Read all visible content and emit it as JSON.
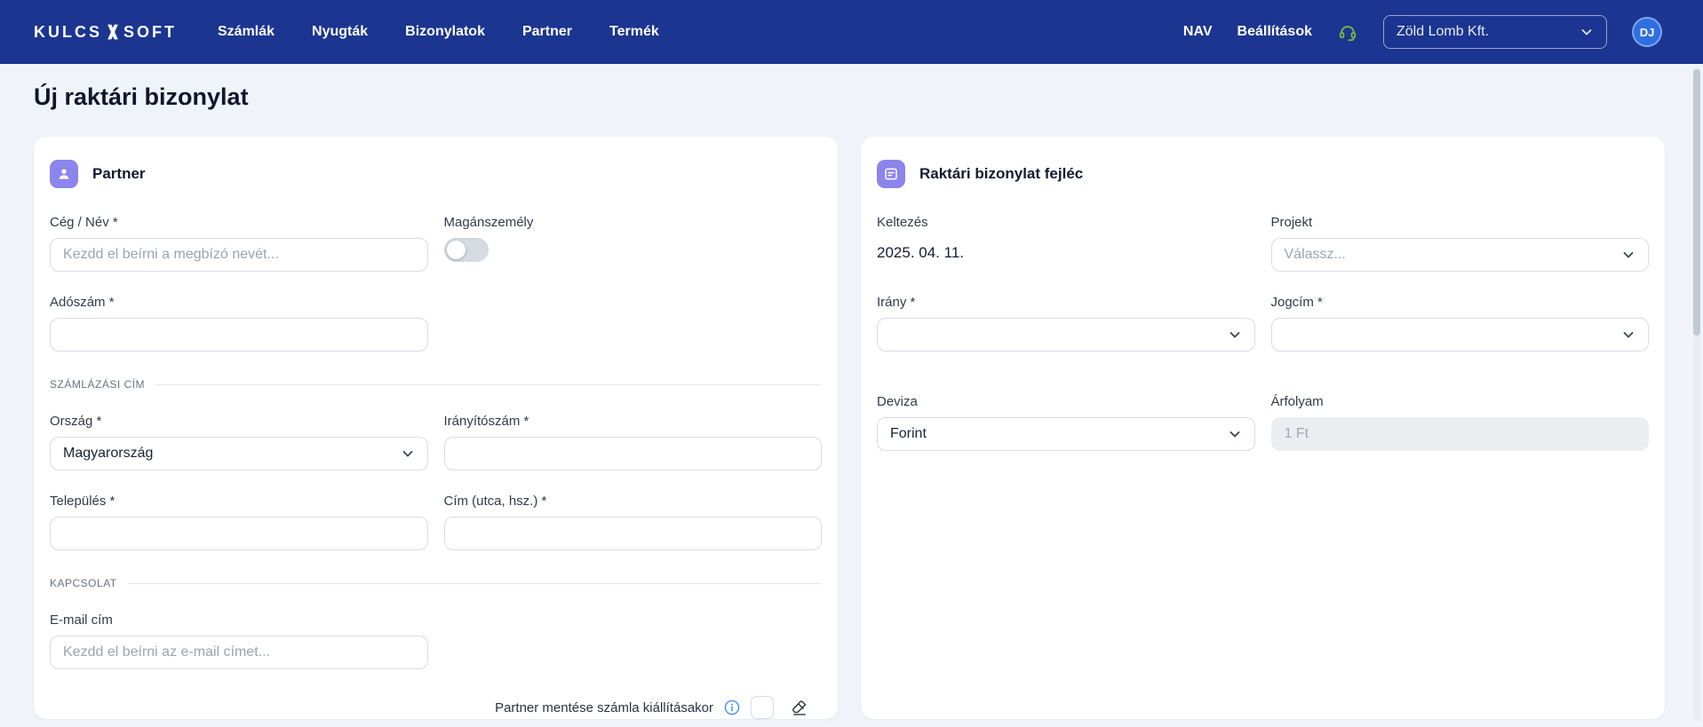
{
  "colors": {
    "nav-blue": "#1c3590",
    "accent-purple": "#8d84ec",
    "avatar-blue": "#2f6fe0",
    "info-blue": "#3f8cf3",
    "support-green": "#7cb93e",
    "page-bg": "#f0f4fa"
  },
  "nav": {
    "logo": {
      "part1": "KULCS",
      "part2": "SOFT"
    },
    "items": [
      {
        "label": "Számlák"
      },
      {
        "label": "Nyugták"
      },
      {
        "label": "Bizonylatok"
      },
      {
        "label": "Partner"
      },
      {
        "label": "Termék"
      }
    ],
    "right": {
      "nav_link": "NAV",
      "settings_link": "Beállítások",
      "company_selector": {
        "value": "Zöld Lomb Kft."
      },
      "avatar_initials": "DJ"
    }
  },
  "page": {
    "title": "Új raktári bizonylat"
  },
  "partner_card": {
    "title": "Partner",
    "sections": {
      "billing": "SZÁMLÁZÁSI CÍM",
      "contact": "KAPCSOLAT"
    },
    "fields": {
      "company_name": {
        "label": "Cég / Név *",
        "placeholder": "Kezdd el beírni a megbízó nevét...",
        "value": ""
      },
      "private_person": {
        "label": "Magánszemély",
        "state": "off"
      },
      "tax_number": {
        "label": "Adószám *",
        "value": ""
      },
      "country": {
        "label": "Ország *",
        "value": "Magyarország"
      },
      "zip": {
        "label": "Irányítószám *",
        "value": ""
      },
      "city": {
        "label": "Település *",
        "value": ""
      },
      "address": {
        "label": "Cím (utca, hsz.) *",
        "value": ""
      },
      "email": {
        "label": "E-mail cím",
        "placeholder": "Kezdd el beírni az e-mail címet...",
        "value": ""
      }
    },
    "footer": {
      "save_label": "Partner mentése számla kiállításakor"
    }
  },
  "header_card": {
    "title": "Raktári bizonylat fejléc",
    "fields": {
      "date": {
        "label": "Keltezés",
        "value": "2025. 04. 11."
      },
      "project": {
        "label": "Projekt",
        "placeholder": "Válassz..."
      },
      "direction": {
        "label": "Irány *",
        "value": ""
      },
      "legal_title": {
        "label": "Jogcím *",
        "value": ""
      },
      "currency": {
        "label": "Deviza",
        "value": "Forint"
      },
      "exchange_rate": {
        "label": "Árfolyam",
        "value": "1 Ft",
        "disabled": true
      }
    }
  }
}
